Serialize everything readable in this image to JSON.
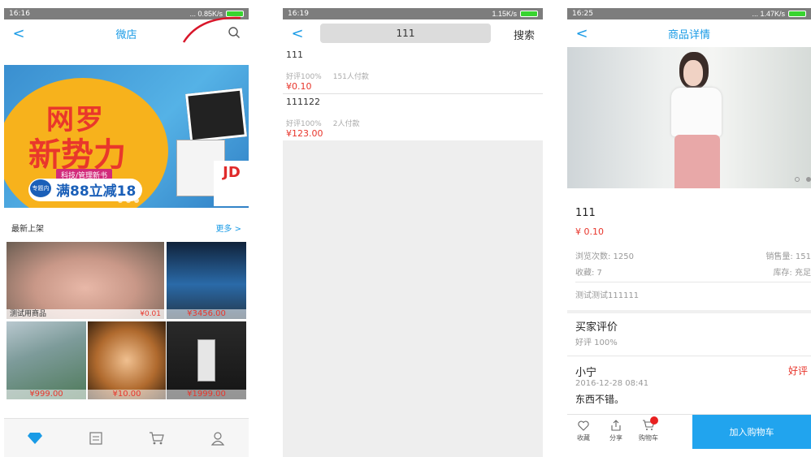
{
  "colors": {
    "accent": "#1a9be6",
    "price": "#e8352b",
    "buy_button": "#21a4ee"
  },
  "panel1": {
    "status": {
      "time": "16:16",
      "net": "... 0.85K/s"
    },
    "nav": {
      "back": "<",
      "title": "微店",
      "search_icon": "search-icon"
    },
    "banner": {
      "line1": "网罗",
      "line2": "新势力",
      "ribbon": "科技/管理新书",
      "badge": "专题内",
      "promo": "满88立减18",
      "brand": "JD"
    },
    "section": {
      "title": "最新上架",
      "more": "更多 >"
    },
    "products": [
      {
        "name": "测试用商品",
        "price": "¥0.01"
      },
      {
        "price": "¥3456.00"
      },
      {
        "price": "¥999.00"
      },
      {
        "price": "¥10.00"
      },
      {
        "price": "¥1999.00"
      }
    ],
    "tabbar": [
      "diamond-icon",
      "list-icon",
      "cart-icon",
      "user-icon"
    ]
  },
  "panel2": {
    "status": {
      "time": "16:19",
      "net": "1.15K/s"
    },
    "nav": {
      "back": "<",
      "query": "111",
      "search_label": "搜索"
    },
    "results": [
      {
        "title": "111",
        "rating": "好评100%",
        "sold": "151人付款",
        "price": "¥0.10"
      },
      {
        "title": "111122",
        "rating": "好评100%",
        "sold": "2人付款",
        "price": "¥123.00"
      }
    ]
  },
  "panel3": {
    "status": {
      "time": "16:25",
      "net": "... 1.47K/s"
    },
    "nav": {
      "back": "<",
      "title": "商品详情"
    },
    "product": {
      "title": "111",
      "price": "¥ 0.10",
      "views": "浏览次数: 1250",
      "sales": "销售量: 151",
      "favorites": "收藏: 7",
      "stock": "库存: 充足",
      "desc": "测试测试111111"
    },
    "reviews": {
      "title": "买家评价",
      "summary": "好评 100%",
      "items": [
        {
          "user": "小宁",
          "badge": "好评",
          "date": "2016-12-28 08:41",
          "text": "东西不错。"
        }
      ]
    },
    "actions": {
      "fav": "收藏",
      "share": "分享",
      "cart": "购物车",
      "add_to_cart": "加入购物车"
    }
  }
}
